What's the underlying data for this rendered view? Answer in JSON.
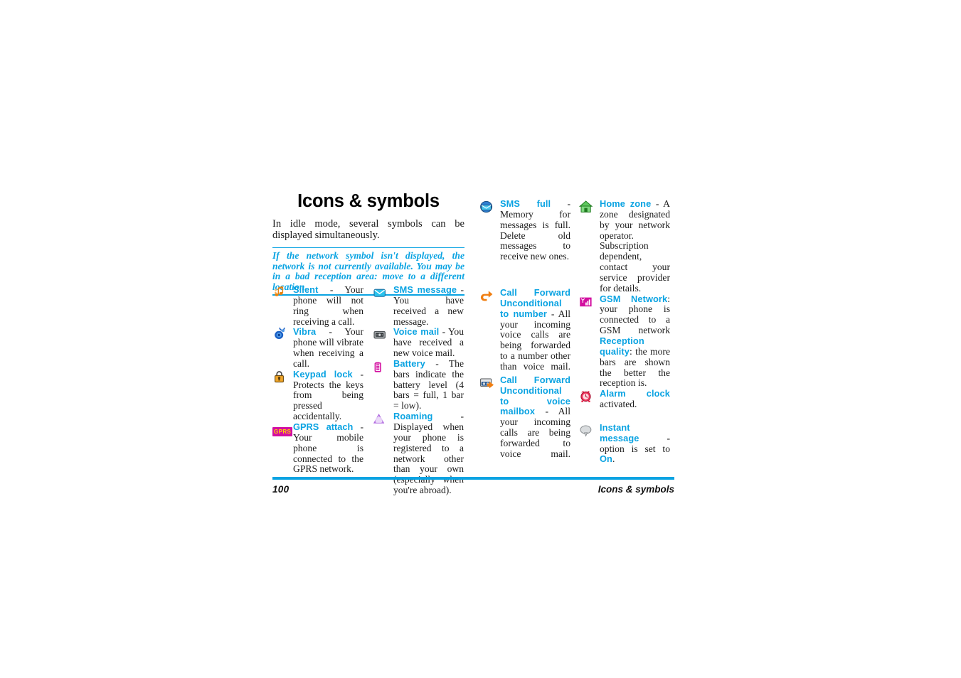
{
  "document": {
    "title": "Icons & symbols",
    "intro": "In idle mode, several symbols can be displayed simultaneously.",
    "note": "If the network symbol isn't displayed, the network is not currently available. You may be in a bad reception area: move to a different location.",
    "footer": {
      "page_number": "100",
      "section": "Icons & symbols"
    }
  },
  "colors": {
    "accent_blue": "#0aa3e2",
    "rule_blue": "#0aa3e2",
    "orange": "#f07f13",
    "magenta": "#d30fa0",
    "green": "#3fae3f",
    "red": "#e8264a",
    "gray": "#8f9396",
    "cyan": "#19b4e0"
  },
  "columns": [
    {
      "id": "column-1",
      "entries": [
        {
          "icon": "silent-note-icon",
          "term": "Silent",
          "description": " - Your phone will not ring when receiving a call."
        },
        {
          "icon": "vibra-icon",
          "term": "Vibra",
          "description": " - Your phone will vibrate when receiving a call."
        },
        {
          "icon": "keypad-lock-padlock-icon",
          "term": "Keypad lock",
          "description": " - Protects the keys from being pressed accidentally."
        },
        {
          "icon": "gprs-attach-badge-icon",
          "term": "GPRS attach",
          "description": " - Your mobile phone is connected to the GPRS network."
        }
      ]
    },
    {
      "id": "column-2",
      "entries": [
        {
          "icon": "sms-message-envelope-icon",
          "term": "SMS message",
          "description": " - You have received a new message."
        },
        {
          "icon": "voice-mail-cassette-icon",
          "term": "Voice mail",
          "description": " - You have received a new voice mail."
        },
        {
          "icon": "battery-icon",
          "term": "Battery",
          "description": " - The bars indicate the battery level (4 bars = full, 1 bar = low)."
        },
        {
          "icon": "roaming-triangle-icon",
          "term": "Roaming",
          "description": " - Displayed when your phone is registered to a network other than your own (especially when you're abroad)."
        }
      ]
    },
    {
      "id": "column-3",
      "entries": [
        {
          "icon": "sms-full-envelope-icon",
          "term": "SMS full",
          "description": " - Memory for messages is full. Delete old messages to receive new ones."
        },
        {
          "icon": "call-forward-arrow-icon",
          "term": "Call Forward Unconditional to number",
          "description": " - All your incoming voice calls are being forwarded to a number other than voice mail."
        },
        {
          "icon": "call-forward-voicemail-icon",
          "term": "Call Forward Unconditional to voice mailbox",
          "description": " - All your incoming calls are being forwarded to voice mail."
        }
      ]
    },
    {
      "id": "column-4",
      "entries": [
        {
          "icon": "home-zone-house-icon",
          "term": "Home zone",
          "description": " - A zone designated by your network operator. Subscription dependent, contact your service provider for details."
        },
        {
          "icon": "gsm-network-signal-icon",
          "term": "GSM Network",
          "description": ": your phone is connected to a GSM network"
        },
        {
          "icon": "",
          "term": "Reception quality",
          "description": ": the more bars are shown the better the reception is."
        },
        {
          "icon": "alarm-clock-icon",
          "term": "Alarm clock",
          "description": " activated."
        },
        {
          "icon": "instant-message-bubble-icon",
          "term": "Instant message",
          "description": " - option is set to ",
          "description_tail_term": "On",
          "description_tail": "."
        }
      ]
    }
  ]
}
